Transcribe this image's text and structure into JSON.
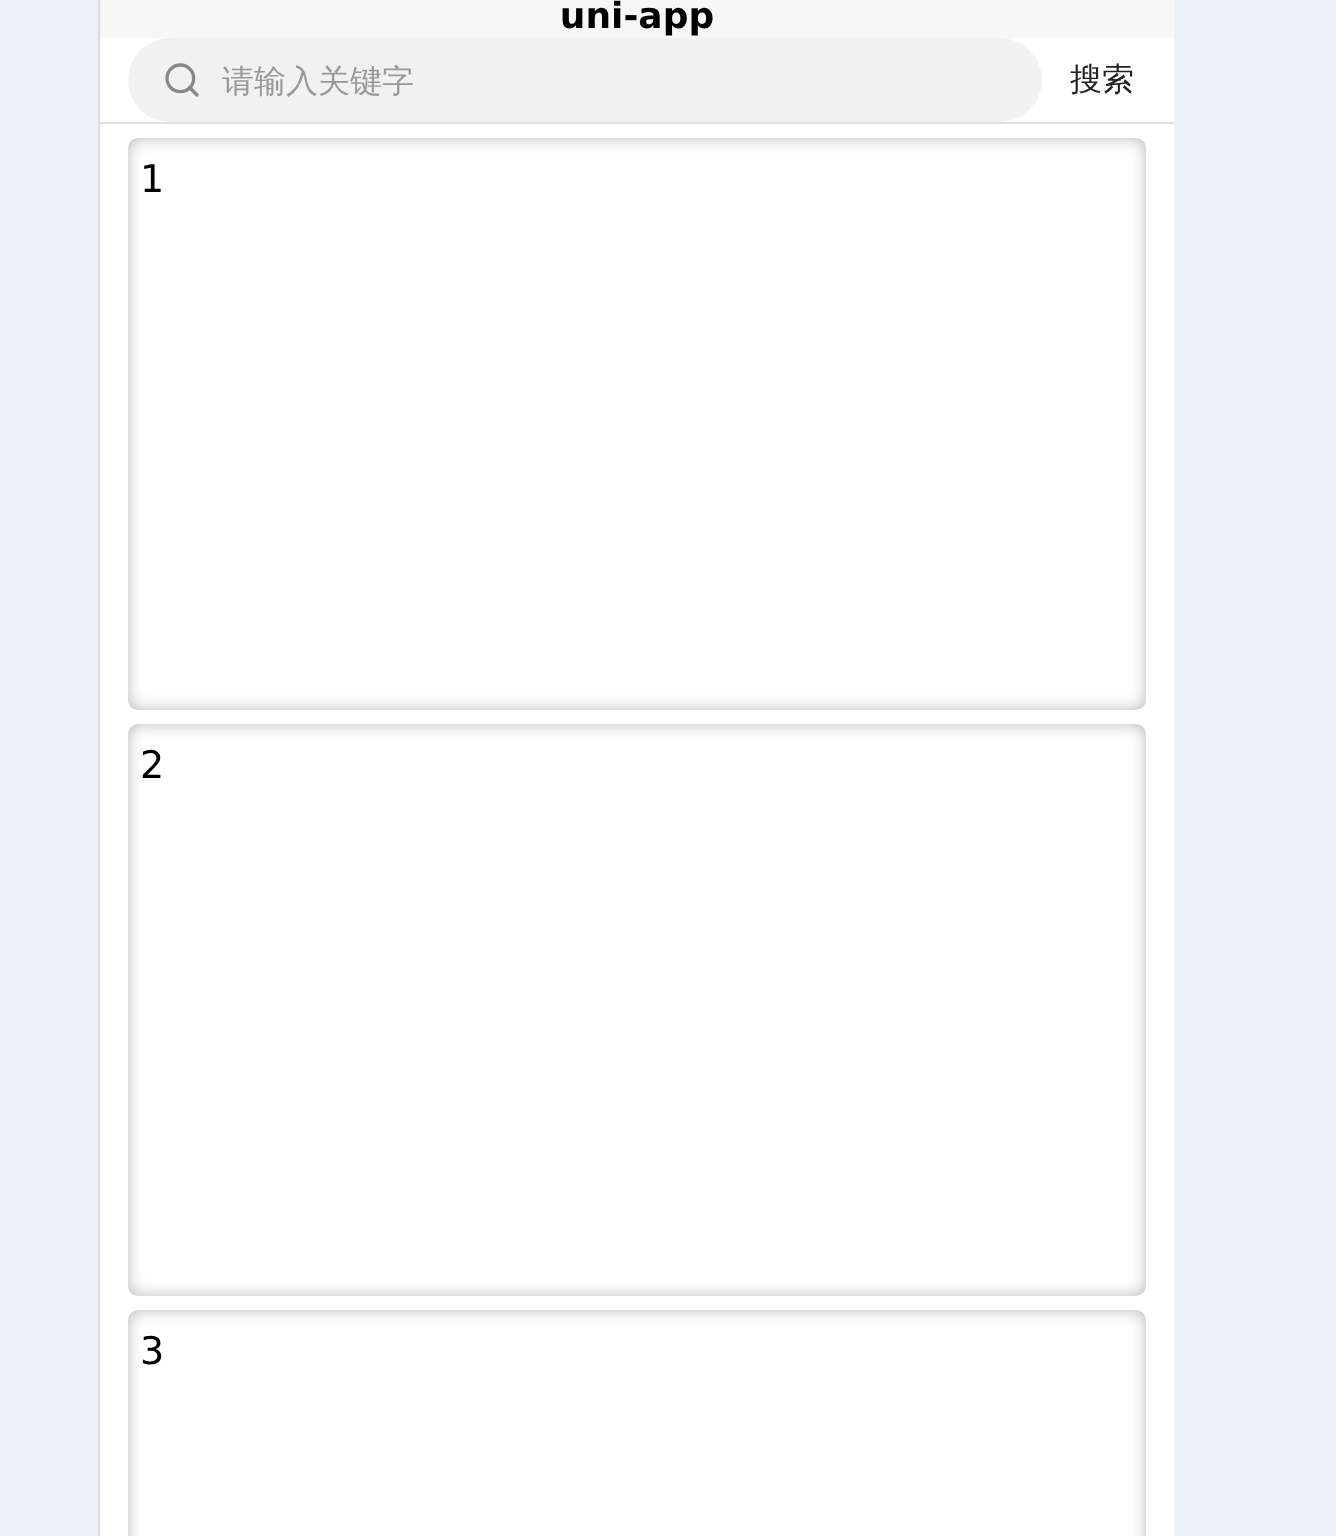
{
  "header": {
    "title": "uni-app"
  },
  "search": {
    "placeholder": "请输入关键字",
    "button": "搜索"
  },
  "cards": [
    {
      "label": "1"
    },
    {
      "label": "2"
    },
    {
      "label": "3"
    }
  ]
}
